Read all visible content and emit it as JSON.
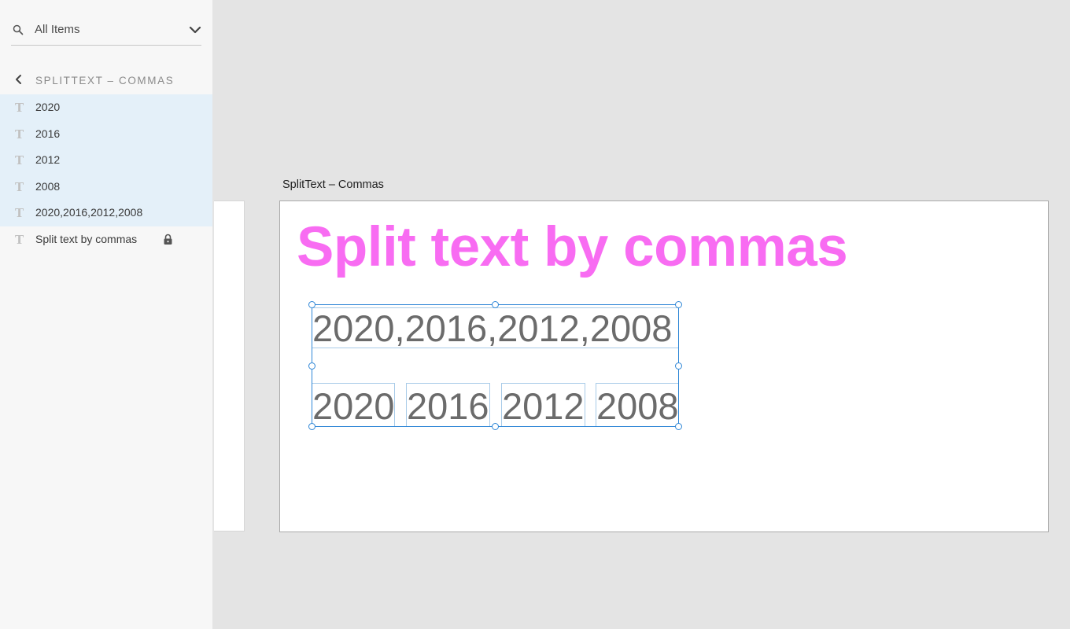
{
  "search": {
    "filter_label": "All Items"
  },
  "breadcrumb": {
    "title": "SPLITTEXT – COMMAS"
  },
  "layers": [
    {
      "name": "2020",
      "icon": "text-layer-icon",
      "selected": true
    },
    {
      "name": "2016",
      "icon": "text-layer-icon",
      "selected": true
    },
    {
      "name": "2012",
      "icon": "text-layer-icon",
      "selected": true
    },
    {
      "name": "2008",
      "icon": "text-layer-icon",
      "selected": true
    },
    {
      "name": "2020,2016,2012,2008",
      "icon": "text-layer-icon",
      "selected": true
    },
    {
      "name": "Split text by commas",
      "icon": "text-layer-icon",
      "selected": false,
      "locked": true
    }
  ],
  "canvas": {
    "artboard_label": "SplitText – Commas",
    "headline": "Split text by commas",
    "joined_text": "2020,2016,2012,2008",
    "pieces": [
      "2020",
      "2016",
      "2012",
      "2008"
    ]
  },
  "colors": {
    "headline": "#f86cf2",
    "selection": "#2e86d6",
    "selected_row": "#e4f0f9"
  }
}
